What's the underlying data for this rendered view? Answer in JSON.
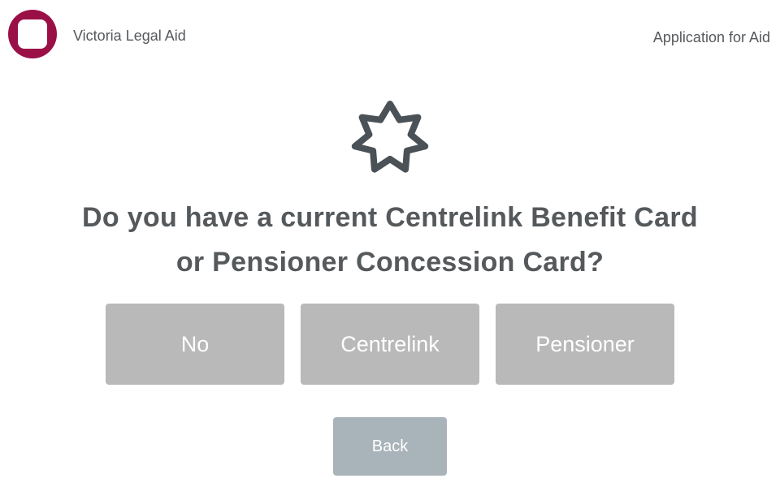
{
  "header": {
    "org_name": "Victoria Legal Aid",
    "page_label": "Application for Aid",
    "logo_color": "#9b0f47"
  },
  "main": {
    "icon": "asterisk-star-icon",
    "question": "Do you have a current Centrelink Benefit Card or Pensioner Concession Card?",
    "options": [
      {
        "label": "No"
      },
      {
        "label": "Centrelink"
      },
      {
        "label": "Pensioner"
      }
    ],
    "back_label": "Back"
  },
  "colors": {
    "option_bg": "#b9b9b9",
    "back_bg": "#a9b3ba",
    "text": "#55595c",
    "icon": "#4a5157"
  }
}
